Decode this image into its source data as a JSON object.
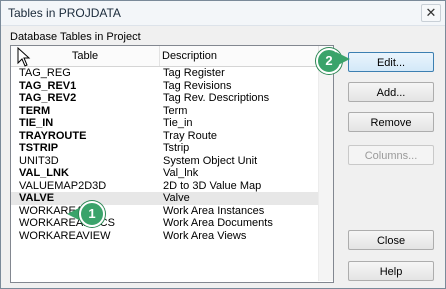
{
  "window": {
    "title": "Tables in PROJDATA",
    "close_glyph": "✕"
  },
  "list": {
    "label": "Database Tables in Project",
    "headers": {
      "table": "Table",
      "description": "Description"
    },
    "rows": [
      {
        "table": "TAG_REG",
        "description": "Tag Register",
        "bold": false
      },
      {
        "table": "TAG_REV1",
        "description": "Tag Revisions",
        "bold": true
      },
      {
        "table": "TAG_REV2",
        "description": "Tag Rev. Descriptions",
        "bold": true
      },
      {
        "table": "TERM",
        "description": "Term",
        "bold": true
      },
      {
        "table": "TIE_IN",
        "description": "Tie_in",
        "bold": true
      },
      {
        "table": "TRAYROUTE",
        "description": "Tray Route",
        "bold": true
      },
      {
        "table": "TSTRIP",
        "description": "Tstrip",
        "bold": true
      },
      {
        "table": "UNIT3D",
        "description": "System Object Unit",
        "bold": false
      },
      {
        "table": "VAL_LNK",
        "description": "Val_lnk",
        "bold": true
      },
      {
        "table": "VALUEMAP2D3D",
        "description": "2D to 3D Value Map",
        "bold": false
      },
      {
        "table": "VALVE",
        "description": "Valve",
        "bold": true,
        "selected": true
      },
      {
        "table": "WORKAREA",
        "description": "Work Area Instances",
        "bold": false
      },
      {
        "table": "WORKAREADOCS",
        "description": "Work Area Documents",
        "bold": false
      },
      {
        "table": "WORKAREAVIEW",
        "description": "Work Area Views",
        "bold": false
      }
    ]
  },
  "buttons": {
    "edit": "Edit...",
    "add": "Add...",
    "remove": "Remove",
    "columns": "Columns...",
    "close": "Close",
    "help": "Help"
  },
  "callouts": {
    "one": "1",
    "two": "2",
    "color": "#3aa36a"
  }
}
